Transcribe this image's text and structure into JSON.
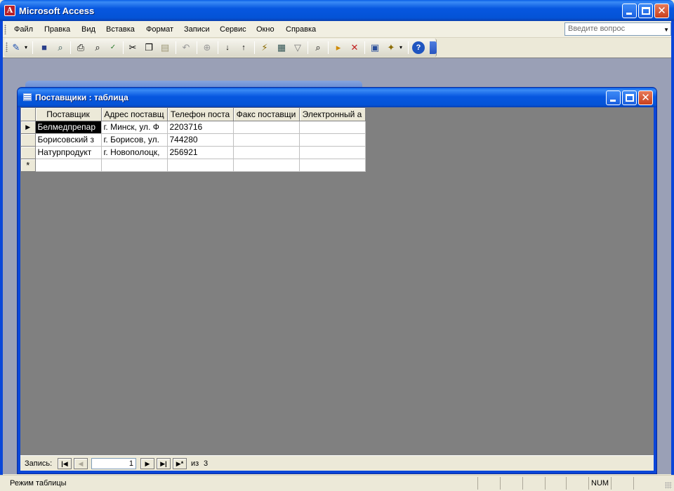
{
  "app": {
    "title": "Microsoft Access"
  },
  "menu": {
    "items": [
      "Файл",
      "Правка",
      "Вид",
      "Вставка",
      "Формат",
      "Записи",
      "Сервис",
      "Окно",
      "Справка"
    ],
    "help_placeholder": "Введите вопрос"
  },
  "toolbar": {
    "icons": [
      "view-icon",
      "save-icon",
      "search-db-icon",
      "print-icon",
      "print-preview-icon",
      "spelling-icon",
      "cut-icon",
      "copy-icon",
      "paste-icon",
      "undo-icon",
      "hyperlink-icon",
      "sort-ascending-icon",
      "sort-descending-icon",
      "filter-by-selection-icon",
      "filter-by-form-icon",
      "apply-filter-icon",
      "find-icon",
      "new-record-icon",
      "delete-record-icon",
      "database-window-icon",
      "new-object-icon",
      "help-icon"
    ]
  },
  "table_window": {
    "title": "Поставщики : таблица",
    "columns": [
      "Поставщик",
      "Адрес поставщ",
      "Телефон поста",
      "Факс поставщи",
      "Электронный а"
    ],
    "rows": [
      [
        "Белмедпрепар",
        "г. Минск, ул. Ф",
        "2203716",
        "",
        ""
      ],
      [
        "Борисовский з",
        "г. Борисов, ул.",
        "744280",
        "",
        ""
      ],
      [
        "Натурпродукт",
        "г. Новополоцк,",
        "256921",
        "",
        ""
      ]
    ],
    "new_row_marker": "*"
  },
  "record_nav": {
    "label": "Запись:",
    "current": "1",
    "of_label": "из",
    "total": "3"
  },
  "status": {
    "mode": "Режим таблицы",
    "num": "NUM"
  }
}
